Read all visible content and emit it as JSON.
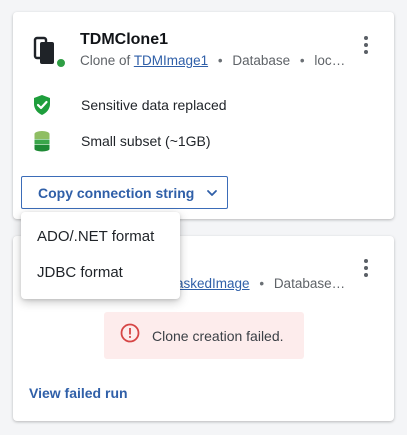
{
  "card1": {
    "title": "TDMClone1",
    "subtitle_prefix": "Clone of",
    "subtitle_link": "TDMImage1",
    "subtitle_type": "Database",
    "subtitle_location": "loca…",
    "status_color": "#2e9e44",
    "features": [
      {
        "icon": "shield-check-icon",
        "label": "Sensitive data replaced"
      },
      {
        "icon": "database-stack-icon",
        "label": "Small subset (~1GB)"
      }
    ],
    "connection_button_label": "Copy connection string"
  },
  "dropdown": {
    "items": [
      "ADO/.NET format",
      "JDBC format"
    ]
  },
  "card2": {
    "subtitle_link": "askedImage",
    "subtitle_type": "Database…",
    "error_message": "Clone creation failed.",
    "failed_link_label": "View failed run"
  },
  "colors": {
    "accent": "#2f5fa8",
    "success": "#1e9e3c",
    "error": "#d64545"
  }
}
